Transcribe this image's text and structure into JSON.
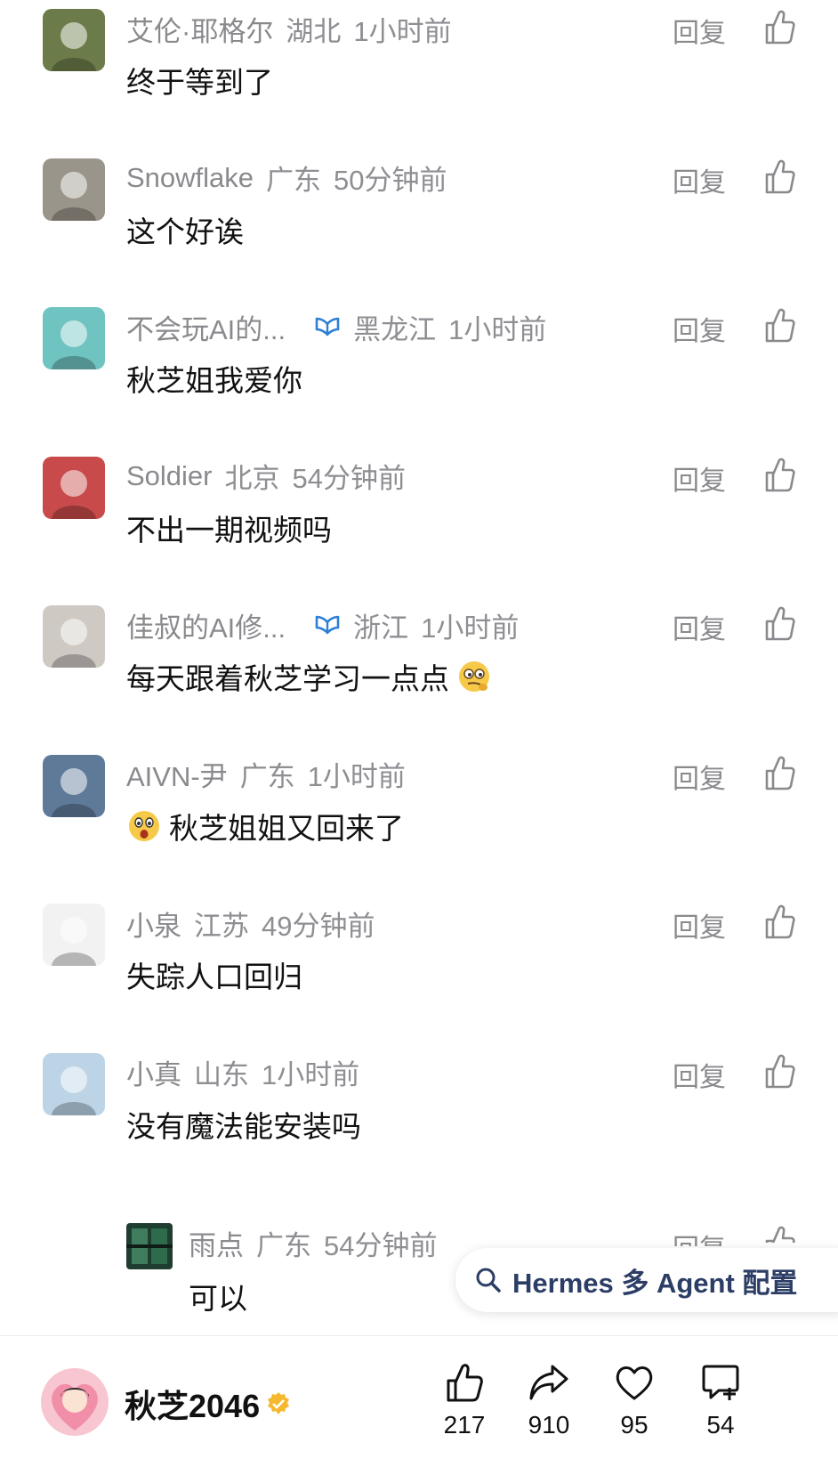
{
  "comments": [
    {
      "name": "艾伦·耶格尔",
      "region": "湖北",
      "time": "1小时前",
      "text": "终于等到了",
      "reply": "回复",
      "avatar_color": "#6b7c4a",
      "verified": false
    },
    {
      "name": "Snowflake",
      "region": "广东",
      "time": "50分钟前",
      "text": "这个好诶",
      "reply": "回复",
      "avatar_color": "#9a958a",
      "verified": false
    },
    {
      "name": "不会玩AI的...",
      "region": "黑龙江",
      "time": "1小时前",
      "text": "秋芝姐我爱你",
      "reply": "回复",
      "avatar_color": "#6fc3c0",
      "verified": true
    },
    {
      "name": "Soldier",
      "region": "北京",
      "time": "54分钟前",
      "text": "不出一期视频吗",
      "reply": "回复",
      "avatar_color": "#c84a4a",
      "verified": false
    },
    {
      "name": "佳叔的AI修...",
      "region": "浙江",
      "time": "1小时前",
      "text": "每天跟着秋芝学习一点点",
      "reply": "回复",
      "avatar_color": "#cfc9c4",
      "verified": true,
      "emoji": "thinking-emoji"
    },
    {
      "name": "AIVN-尹",
      "region": "广东",
      "time": "1小时前",
      "text": "秋芝姐姐又回来了",
      "reply": "回复",
      "avatar_color": "#5f7a99",
      "verified": false,
      "leading_emoji": "surprised-emoji"
    },
    {
      "name": "小泉",
      "region": "江苏",
      "time": "49分钟前",
      "text": "失踪人口回归",
      "reply": "回复",
      "avatar_color": "#f2f2f2",
      "verified": false
    },
    {
      "name": "小真",
      "region": "山东",
      "time": "1小时前",
      "text": "没有魔法能安装吗",
      "reply": "回复",
      "avatar_color": "#bcd4e6",
      "verified": false
    }
  ],
  "subreply": {
    "name": "雨点",
    "region": "广东",
    "time": "54分钟前",
    "text": "可以",
    "reply": "回复",
    "avatar_color": "#2f5a45"
  },
  "search_chip": {
    "label": "Hermes 多 Agent 配置",
    "icon": "search-icon"
  },
  "author": {
    "name": "秋芝2046",
    "verified": true
  },
  "actions": {
    "likes": "217",
    "shares": "910",
    "favorites": "95",
    "comments": "54"
  },
  "colors": {
    "meta_gray": "#8e8e93",
    "text": "#111111",
    "verify_gold": "#f5b82e",
    "badge_blue": "#2f7fd6"
  }
}
